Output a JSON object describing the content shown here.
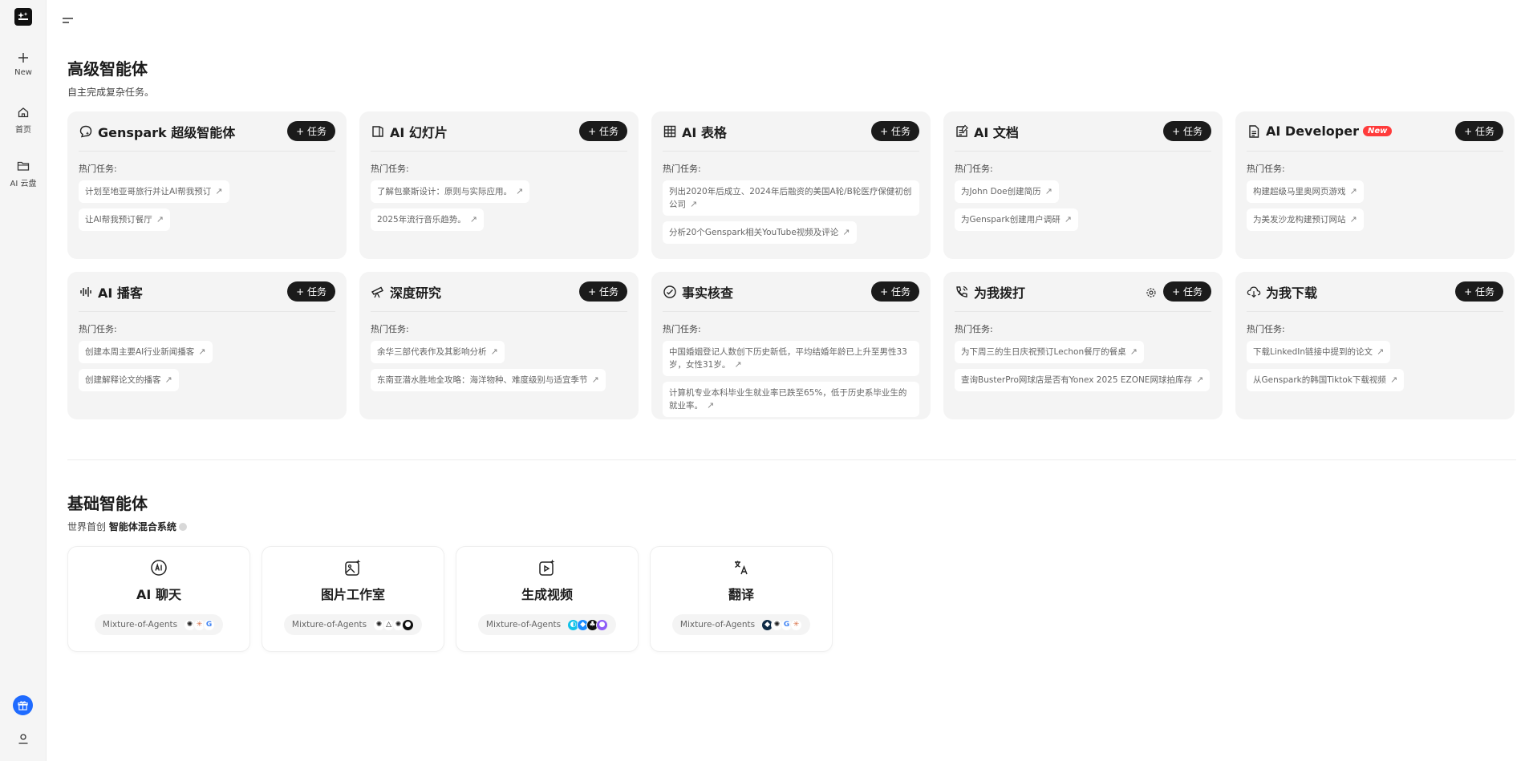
{
  "sidebar": {
    "new_label": "New",
    "home_label": "首页",
    "drive_label": "AI 云盘"
  },
  "advanced": {
    "title": "高级智能体",
    "subtitle": "自主完成复杂任务。",
    "hot_label": "热门任务:",
    "task_button": "+ 任务",
    "cards": [
      {
        "icon": "spark-bubble-icon",
        "title": "Genspark 超级智能体",
        "badge": "",
        "tasks": [
          "计划至地亚哥旅行并让AI帮我预订",
          "让AI帮我预订餐厅"
        ]
      },
      {
        "icon": "slides-icon",
        "title": "AI 幻灯片",
        "badge": "",
        "tasks": [
          "了解包豪斯设计：原则与实际应用。",
          "2025年流行音乐趋势。"
        ]
      },
      {
        "icon": "table-icon",
        "title": "AI 表格",
        "badge": "",
        "tasks": [
          "列出2020年后成立、2024年后融资的美国A轮/B轮医疗保健初创公司",
          "分析20个Genspark相关YouTube视频及评论"
        ]
      },
      {
        "icon": "document-icon",
        "title": "AI 文档",
        "badge": "",
        "tasks": [
          "为John Doe创建简历",
          "为Genspark创建用户调研"
        ]
      },
      {
        "icon": "file-code-icon",
        "title": "AI Developer",
        "badge": "New",
        "tasks": [
          "构建超级马里奥网页游戏",
          "为美发沙龙构建预订网站"
        ]
      },
      {
        "icon": "podcast-icon",
        "title": "AI 播客",
        "badge": "",
        "tasks": [
          "创建本周主要AI行业新闻播客",
          "创建解释论文的播客"
        ]
      },
      {
        "icon": "telescope-icon",
        "title": "深度研究",
        "badge": "",
        "tasks": [
          "余华三部代表作及其影响分析",
          "东南亚潜水胜地全攻略：海洋物种、难度级别与适宜季节"
        ]
      },
      {
        "icon": "check-circle-icon",
        "title": "事实核查",
        "badge": "",
        "tasks": [
          "中国婚姻登记人数创下历史新低，平均结婚年龄已上升至男性33岁，女性31岁。",
          "计算机专业本科毕业生就业率已跌至65%，低于历史系毕业生的就业率。"
        ]
      },
      {
        "icon": "phone-icon",
        "title": "为我拨打",
        "badge": "",
        "gear": true,
        "tasks": [
          "为下周三的生日庆祝预订Lechon餐厅的餐桌",
          "查询BusterPro网球店是否有Yonex 2025 EZONE网球拍库存"
        ]
      },
      {
        "icon": "cloud-download-icon",
        "title": "为我下载",
        "badge": "",
        "tasks": [
          "下载LinkedIn链接中提到的论文",
          "从Genspark的韩国Tiktok下载视频"
        ]
      }
    ]
  },
  "basic": {
    "title": "基础智能体",
    "subtitle_prefix": "世界首创",
    "subtitle_bold": "智能体混合系统",
    "moa_label": "Mixture-of-Agents",
    "cards": [
      {
        "icon": "ai-chat-icon",
        "title": "AI 聊天"
      },
      {
        "icon": "image-studio-icon",
        "title": "图片工作室"
      },
      {
        "icon": "video-generate-icon",
        "title": "生成视频"
      },
      {
        "icon": "translate-icon",
        "title": "翻译"
      }
    ]
  },
  "colors": {
    "accent_dark": "#1b1b1b",
    "new_badge": "#ff3b3b",
    "gift_blue": "#1f6bff",
    "card_bg": "#f4f4f4"
  }
}
